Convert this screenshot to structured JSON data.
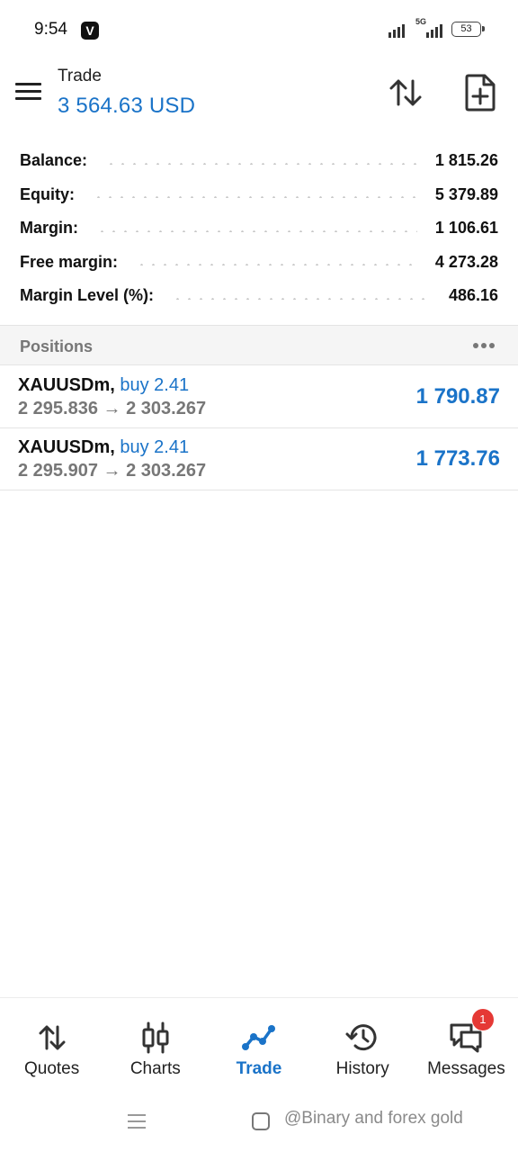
{
  "status_bar": {
    "time": "9:54",
    "app_badge": "V",
    "network_label": "5G",
    "battery": "53"
  },
  "header": {
    "title": "Trade",
    "balance": "3 564.63 USD",
    "sort_icon": "sort-arrows-icon",
    "new_order_icon": "new-order-icon"
  },
  "summary": [
    {
      "label": "Balance:",
      "value": "1 815.26"
    },
    {
      "label": "Equity:",
      "value": "5 379.89"
    },
    {
      "label": "Margin:",
      "value": "1 106.61"
    },
    {
      "label": "Free margin:",
      "value": "4 273.28"
    },
    {
      "label": "Margin Level (%):",
      "value": "486.16"
    }
  ],
  "positions": {
    "title": "Positions",
    "items": [
      {
        "symbol": "XAUUSDm,",
        "side": "buy 2.41",
        "prices": "2 295.836 → 2 303.267",
        "profit": "1 790.87"
      },
      {
        "symbol": "XAUUSDm,",
        "side": "buy 2.41",
        "prices": "2 295.907 → 2 303.267",
        "profit": "1 773.76"
      }
    ]
  },
  "bottom_nav": [
    {
      "label": "Quotes",
      "icon": "quotes-icon",
      "active": false
    },
    {
      "label": "Charts",
      "icon": "charts-icon",
      "active": false
    },
    {
      "label": "Trade",
      "icon": "trade-icon",
      "active": true
    },
    {
      "label": "History",
      "icon": "history-icon",
      "active": false
    },
    {
      "label": "Messages",
      "icon": "messages-icon",
      "active": false,
      "badge": "1"
    }
  ],
  "watermark": "@Binary and forex gold",
  "colors": {
    "accent": "#1a73c8",
    "badge": "#e53935",
    "muted_text": "#777777"
  }
}
